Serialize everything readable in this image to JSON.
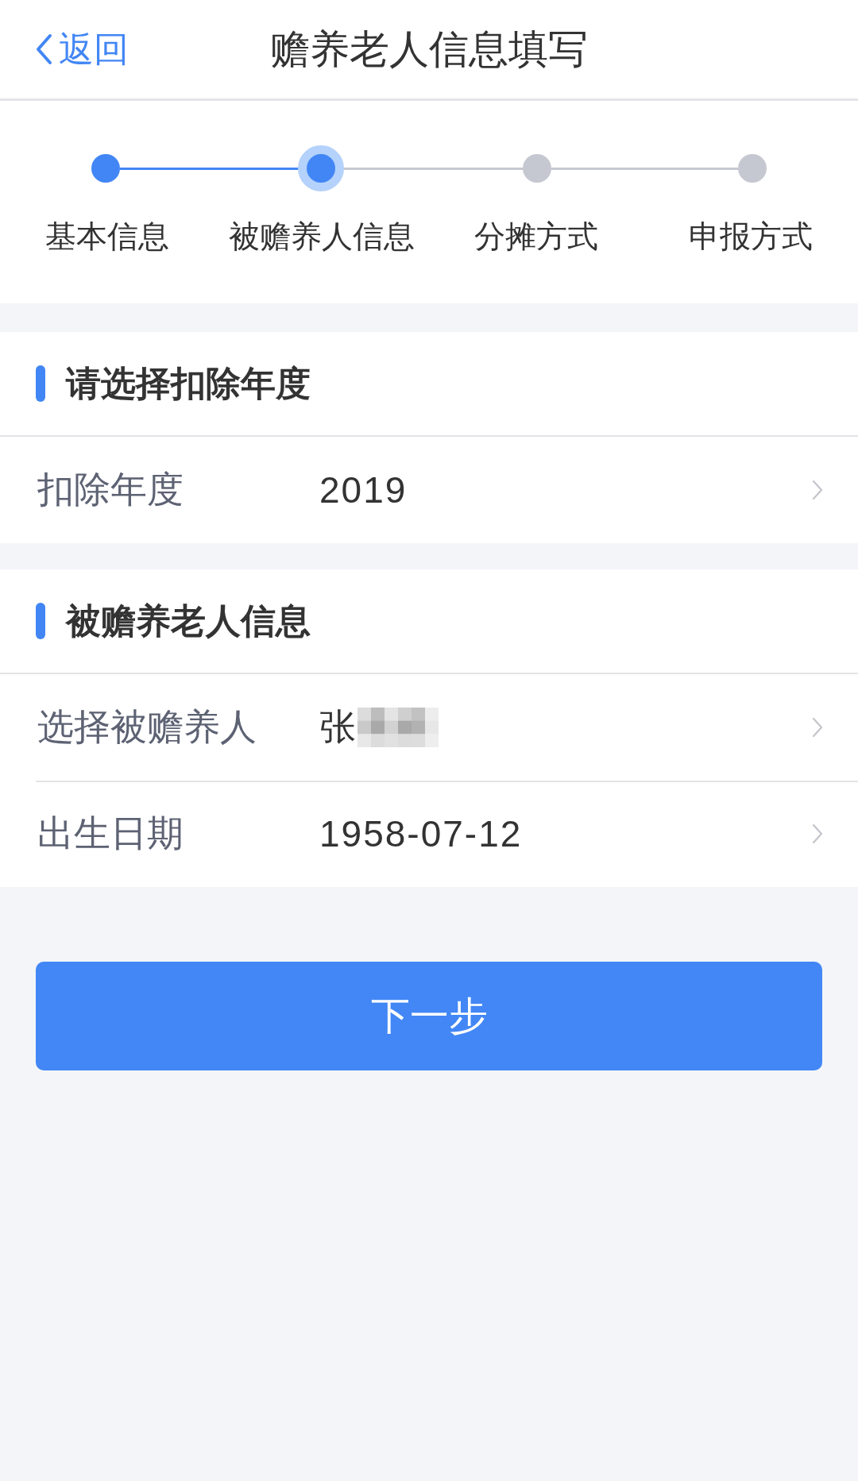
{
  "header": {
    "back_label": "返回",
    "title": "赡养老人信息填写"
  },
  "steps": [
    {
      "label": "基本信息",
      "completed": true,
      "selected": false
    },
    {
      "label": "被赡养人信息",
      "completed": false,
      "selected": true
    },
    {
      "label": "分摊方式",
      "completed": false,
      "selected": false
    },
    {
      "label": "申报方式",
      "completed": false,
      "selected": false
    }
  ],
  "sections": [
    {
      "title": "请选择扣除年度",
      "rows": [
        {
          "label": "扣除年度",
          "value": "2019",
          "redacted": false
        }
      ]
    },
    {
      "title": "被赡养老人信息",
      "rows": [
        {
          "label": "选择被赡养人",
          "value": "张",
          "redacted": true
        },
        {
          "label": "出生日期",
          "value": "1958-07-12",
          "redacted": false
        }
      ]
    }
  ],
  "next_button": {
    "label": "下一步"
  }
}
